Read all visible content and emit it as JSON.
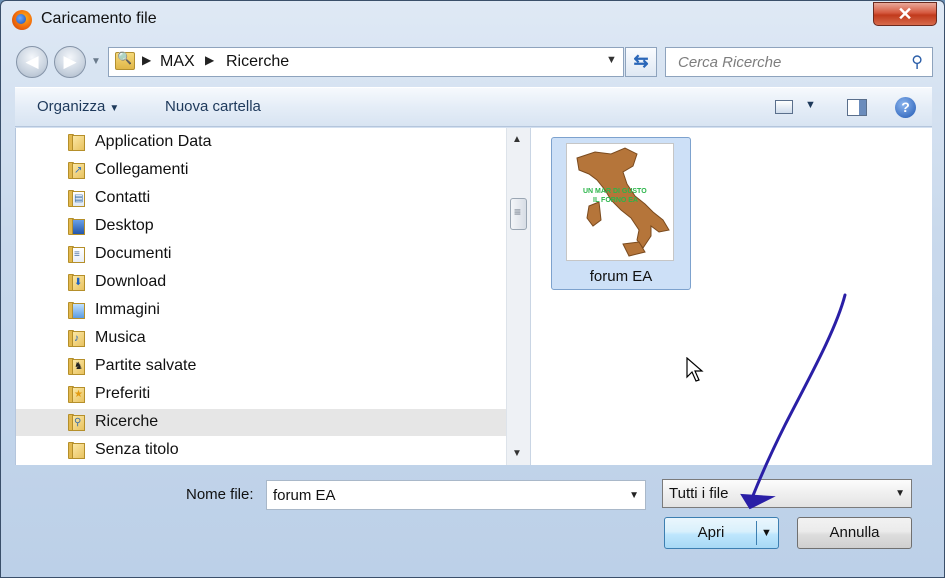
{
  "window": {
    "title": "Caricamento file",
    "close_label": "✕"
  },
  "navigation": {
    "back_icon": "arrow-left-icon",
    "forward_icon": "arrow-right-icon",
    "breadcrumbs": [
      "MAX",
      "Ricerche"
    ],
    "search_placeholder": "Cerca Ricerche"
  },
  "toolbar": {
    "organize_label": "Organizza",
    "new_folder_label": "Nuova cartella",
    "help_label": "?"
  },
  "sidebar": {
    "items": [
      {
        "label": "Application Data",
        "icon": "folder-icon",
        "selected": false
      },
      {
        "label": "Collegamenti",
        "icon": "links-folder-icon",
        "selected": false
      },
      {
        "label": "Contatti",
        "icon": "contacts-folder-icon",
        "selected": false
      },
      {
        "label": "Desktop",
        "icon": "desktop-folder-icon",
        "selected": false
      },
      {
        "label": "Documenti",
        "icon": "documents-folder-icon",
        "selected": false
      },
      {
        "label": "Download",
        "icon": "downloads-folder-icon",
        "selected": false
      },
      {
        "label": "Immagini",
        "icon": "pictures-folder-icon",
        "selected": false
      },
      {
        "label": "Musica",
        "icon": "music-folder-icon",
        "selected": false
      },
      {
        "label": "Partite salvate",
        "icon": "saved-games-folder-icon",
        "selected": false
      },
      {
        "label": "Preferiti",
        "icon": "favorites-folder-icon",
        "selected": false
      },
      {
        "label": "Ricerche",
        "icon": "searches-folder-icon",
        "selected": true
      },
      {
        "label": "Senza titolo",
        "icon": "folder-icon",
        "selected": false
      }
    ]
  },
  "content": {
    "files": [
      {
        "name": "forum EA",
        "thumbnail_text": [
          "UN MAR DI GUSTO",
          "IL FORNO EA"
        ],
        "selected": true
      }
    ]
  },
  "footer": {
    "filename_label": "Nome file:",
    "filename_value": "forum EA",
    "filter_value": "Tutti i file",
    "open_label": "Apri",
    "cancel_label": "Annulla"
  },
  "colors": {
    "selection": "#cde0f7",
    "annotation_arrow": "#2a1fa6",
    "thumbnail_map": "#b5753a",
    "thumbnail_text": "#2bb54a"
  }
}
